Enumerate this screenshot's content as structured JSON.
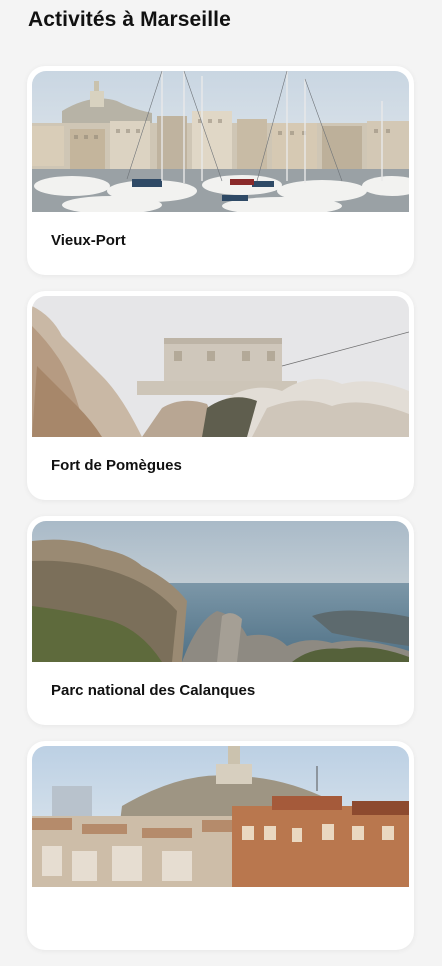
{
  "header": {
    "title": "Activités à Marseille"
  },
  "activities": [
    {
      "name": "Vieux-Port"
    },
    {
      "name": "Fort de Pomègues"
    },
    {
      "name": "Parc national des Calanques"
    },
    {
      "name": ""
    }
  ]
}
